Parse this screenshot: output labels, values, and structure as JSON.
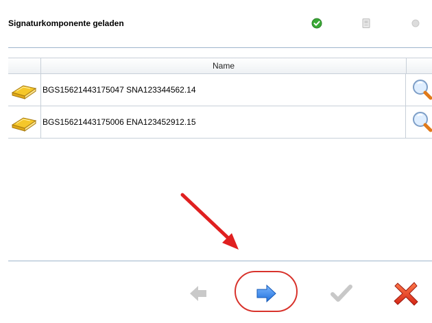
{
  "header": {
    "title": "Signaturkomponente geladen",
    "status_icons": [
      "check-circle-icon",
      "card-icon",
      "dot-icon"
    ]
  },
  "table": {
    "column_header": "Name",
    "rows": [
      {
        "icon": "book-icon",
        "name": "BGS15621443175047 SNA123344562.14",
        "action_icon": "magnifier-icon"
      },
      {
        "icon": "book-icon",
        "name": "BGS15621443175006 ENA123452912.15",
        "action_icon": "magnifier-icon"
      }
    ]
  },
  "toolbar": {
    "buttons": [
      "back-arrow-icon",
      "forward-arrow-icon",
      "checkmark-icon",
      "cancel-x-icon"
    ]
  },
  "colors": {
    "accent_blue": "#2f7fe6",
    "annotation_red": "#e02020",
    "check_green": "#39a935"
  }
}
